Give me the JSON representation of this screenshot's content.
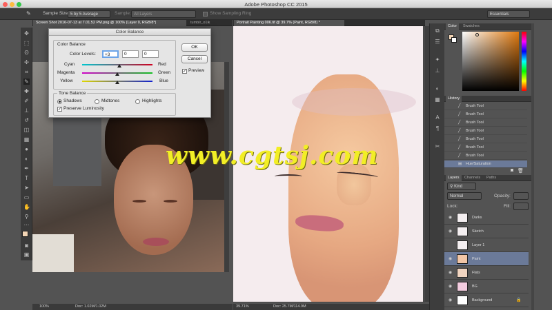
{
  "app": {
    "title": "Adobe Photoshop CC 2015"
  },
  "options_bar": {
    "sample_size_label": "Sample Size:",
    "sample_size_value": "5 by 5 Average",
    "sample_label": "Sample:",
    "sample_value": "All Layers",
    "show_ring_label": "Show Sampling Ring",
    "workspace": "Essentials"
  },
  "documents": [
    {
      "tab": "Screen Shot 2016-07-13 at 7.01.52 PM.png @ 100% (Layer 0, RGB/8*)",
      "zoom": "100%",
      "doc_size": "Doc: 1.02M/1.02M"
    },
    {
      "tab": "tumblr_o1ik",
      "zoom": "",
      "doc_size": ""
    },
    {
      "tab": "Portrait Painting 006.tif @ 39.7% (Paint, RGB/8) *",
      "zoom": "39.71%",
      "doc_size": "Doc: 25.7M/114.9M"
    }
  ],
  "dialog": {
    "title": "Color Balance",
    "group_title": "Color Balance",
    "levels_label": "Color Levels:",
    "levels": [
      "+3",
      "0",
      "0"
    ],
    "sliders": [
      {
        "left": "Cyan",
        "right": "Red",
        "position": 0.53
      },
      {
        "left": "Magenta",
        "right": "Green",
        "position": 0.5
      },
      {
        "left": "Yellow",
        "right": "Blue",
        "position": 0.5
      }
    ],
    "tone_title": "Tone Balance",
    "tones": [
      "Shadows",
      "Midtones",
      "Highlights"
    ],
    "selected_tone": "Shadows",
    "preserve_label": "Preserve Luminosity",
    "ok_label": "OK",
    "cancel_label": "Cancel",
    "preview_label": "Preview"
  },
  "color_panel": {
    "tabs": [
      "Color",
      "Swatches"
    ],
    "foreground": "#f3d5b5",
    "background": "#ffffff"
  },
  "history_panel": {
    "title": "History",
    "items": [
      "Brush Tool",
      "Brush Tool",
      "Brush Tool",
      "Brush Tool",
      "Brush Tool",
      "Brush Tool",
      "Brush Tool",
      "Hue/Saturation"
    ]
  },
  "layers_panel": {
    "tabs": [
      "Layers",
      "Channels",
      "Paths"
    ],
    "filter": "Kind",
    "blend": "Normal",
    "opacity_label": "Opacity:",
    "lock_label": "Lock:",
    "fill_label": "Fill:",
    "layers": [
      {
        "name": "Darks",
        "selected": false
      },
      {
        "name": "Sketch",
        "selected": false
      },
      {
        "name": "Layer 1",
        "selected": false
      },
      {
        "name": "Paint",
        "selected": true
      },
      {
        "name": "Flats",
        "selected": false
      },
      {
        "name": "BG",
        "selected": false
      },
      {
        "name": "Background",
        "selected": false
      }
    ]
  },
  "watermark": "www.cgtsj.com"
}
